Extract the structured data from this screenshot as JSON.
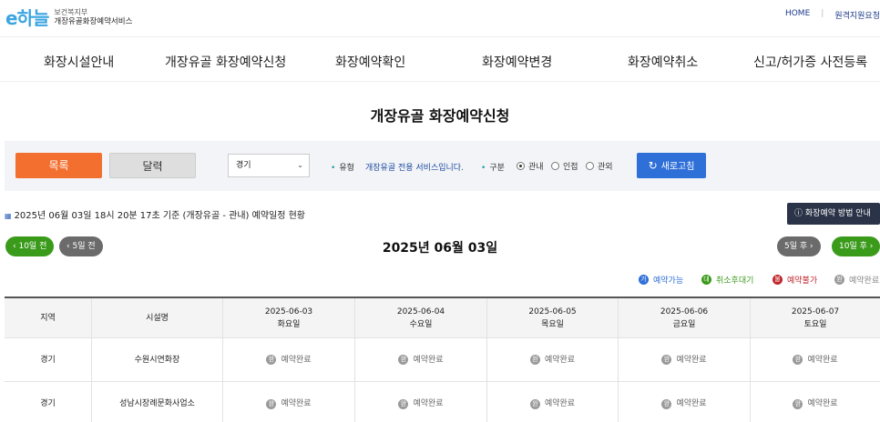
{
  "header": {
    "logo_mark": "e하늘",
    "ministry": "보건복지부",
    "service_name": "개장유골화장예약서비스",
    "links": [
      "HOME",
      "원격지원요청"
    ]
  },
  "nav": {
    "items": [
      "화장시설안내",
      "개장유골 화장예약신청",
      "화장예약확인",
      "화장예약변경",
      "화장예약취소",
      "신고/허가증 사전등록"
    ]
  },
  "page_title": "개장유골 화장예약신청",
  "filter": {
    "list_button": "목록",
    "calendar_button": "달력",
    "region_selected": "경기",
    "type_label": "유형",
    "type_value": "개장유골 전용 서비스입니다.",
    "scope_label": "구분",
    "scope_options": [
      "관내",
      "인접",
      "관외"
    ],
    "scope_selected": "관내",
    "refresh_button": "새로고침"
  },
  "status_text": "2025년 06월 03일 18시 20분 17초 기준 (개장유골 - 관내) 예약일정 현황",
  "guide_button": "화장예약 방법 안내",
  "date_nav": {
    "prev10": "10일 전",
    "prev5": "5일 전",
    "current_date": "2025년 06월 03일",
    "next5": "5일 후",
    "next10": "10일 후"
  },
  "legend": [
    {
      "icon": "가",
      "label": "예약가능",
      "color": "#2f6fd8"
    },
    {
      "icon": "대",
      "label": "취소후대기",
      "color": "#3a9a1a"
    },
    {
      "icon": "불",
      "label": "예약불가",
      "color": "#c0262b"
    },
    {
      "icon": "완",
      "label": "예약완료",
      "color": "#9a9a9a"
    }
  ],
  "table": {
    "col_region": "지역",
    "col_facility": "시설명",
    "dates": [
      {
        "date": "2025-06-03",
        "day": "화요일"
      },
      {
        "date": "2025-06-04",
        "day": "수요일"
      },
      {
        "date": "2025-06-05",
        "day": "목요일"
      },
      {
        "date": "2025-06-06",
        "day": "금요일"
      },
      {
        "date": "2025-06-07",
        "day": "토요일"
      }
    ],
    "rows": [
      {
        "region": "경기",
        "facility": "수원시연화장",
        "status": [
          "예약완료",
          "예약완료",
          "예약완료",
          "예약완료",
          "예약완료"
        ]
      },
      {
        "region": "경기",
        "facility": "성남시장례문화사업소",
        "status": [
          "예약완료",
          "예약완료",
          "예약완료",
          "예약완료",
          "예약완료"
        ]
      }
    ],
    "status_icon": "완"
  }
}
